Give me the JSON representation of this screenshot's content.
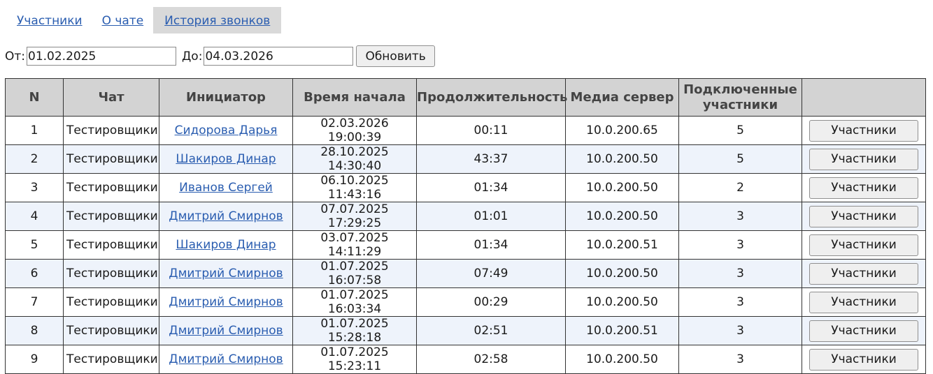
{
  "tabs": [
    {
      "label": "Участники",
      "active": false
    },
    {
      "label": "О чате",
      "active": false
    },
    {
      "label": "История звонков",
      "active": true
    }
  ],
  "filter": {
    "from_label": "От:",
    "from_value": "01.02.2025",
    "to_label": "До:",
    "to_value": "04.03.2026",
    "refresh_label": "Обновить"
  },
  "table": {
    "headers": [
      "N",
      "Чат",
      "Инициатор",
      "Время начала",
      "Продолжительность",
      "Медиа сервер",
      "Подключенные участники",
      ""
    ],
    "button_label": "Участники",
    "rows": [
      {
        "n": "1",
        "chat": "Тестировщики",
        "initiator": "Сидорова Дарья",
        "start": "02.03.2026 19:00:39",
        "duration": "00:11",
        "server": "10.0.200.65",
        "participants": "5"
      },
      {
        "n": "2",
        "chat": "Тестировщики",
        "initiator": "Шакиров Динар",
        "start": "28.10.2025 14:30:40",
        "duration": "43:37",
        "server": "10.0.200.50",
        "participants": "5"
      },
      {
        "n": "3",
        "chat": "Тестировщики",
        "initiator": "Иванов Сергей",
        "start": "06.10.2025 11:43:16",
        "duration": "01:34",
        "server": "10.0.200.50",
        "participants": "2"
      },
      {
        "n": "4",
        "chat": "Тестировщики",
        "initiator": "Дмитрий Смирнов",
        "start": "07.07.2025 17:29:25",
        "duration": "01:01",
        "server": "10.0.200.50",
        "participants": "3"
      },
      {
        "n": "5",
        "chat": "Тестировщики",
        "initiator": "Шакиров Динар",
        "start": "03.07.2025 14:11:29",
        "duration": "01:34",
        "server": "10.0.200.51",
        "participants": "3"
      },
      {
        "n": "6",
        "chat": "Тестировщики",
        "initiator": "Дмитрий Смирнов",
        "start": "01.07.2025 16:07:58",
        "duration": "07:49",
        "server": "10.0.200.50",
        "participants": "3"
      },
      {
        "n": "7",
        "chat": "Тестировщики",
        "initiator": "Дмитрий Смирнов",
        "start": "01.07.2025 16:03:34",
        "duration": "00:29",
        "server": "10.0.200.50",
        "participants": "3"
      },
      {
        "n": "8",
        "chat": "Тестировщики",
        "initiator": "Дмитрий Смирнов",
        "start": "01.07.2025 15:28:18",
        "duration": "02:51",
        "server": "10.0.200.51",
        "participants": "3"
      },
      {
        "n": "9",
        "chat": "Тестировщики",
        "initiator": "Дмитрий Смирнов",
        "start": "01.07.2025 15:23:11",
        "duration": "02:58",
        "server": "10.0.200.50",
        "participants": "3"
      }
    ]
  }
}
